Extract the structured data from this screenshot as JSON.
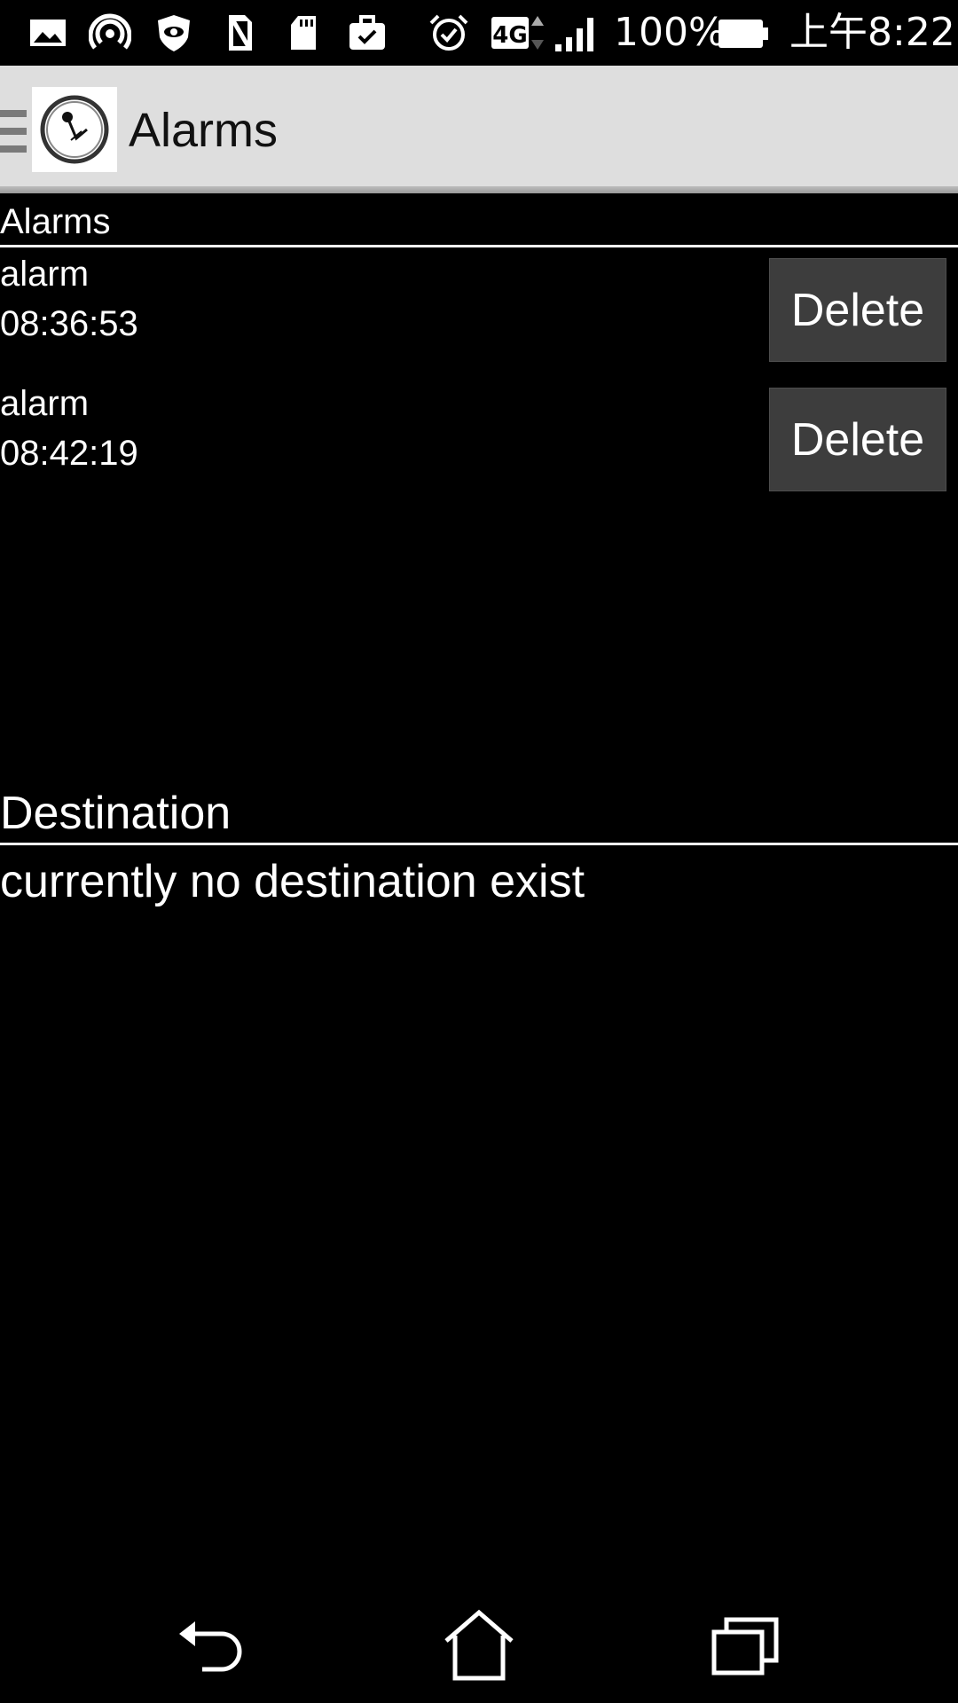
{
  "status_bar": {
    "battery_percent": "100%",
    "time": "上午8:22",
    "network_type": "4G",
    "icons": [
      "gallery-icon",
      "hotspot-icon",
      "shield-eye-icon",
      "no-sim-icon",
      "sd-card-icon",
      "briefcase-check-icon",
      "alarm-clock-icon",
      "network-4g-icon",
      "signal-icon",
      "battery-icon"
    ]
  },
  "action_bar": {
    "title": "Alarms",
    "logo_icon": "clock-logo-icon",
    "drawer_icon": "menu-icon"
  },
  "alarms_section": {
    "header": "Alarms",
    "items": [
      {
        "name": "alarm",
        "time": "08:36:53",
        "delete_label": "Delete"
      },
      {
        "name": "alarm",
        "time": "08:42:19",
        "delete_label": "Delete"
      }
    ]
  },
  "destination_section": {
    "header": "Destination",
    "empty_message": "currently no destination exist"
  },
  "nav_bar": {
    "icons": [
      "back-icon",
      "home-icon",
      "recents-icon"
    ]
  },
  "colors": {
    "background": "#000000",
    "action_bar": "#dedede",
    "button": "#3d3d3d",
    "text": "#ffffff"
  }
}
